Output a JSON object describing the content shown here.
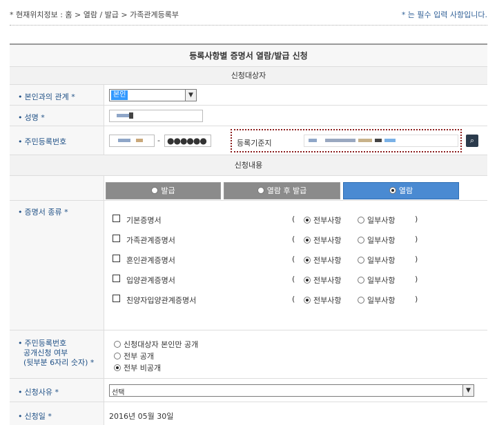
{
  "topbar": {
    "location": "* 현재위치정보 : 홈 > 열람 / 발급 > 가족관계등록부",
    "required_note": "* 는 필수 입력 사항입니다."
  },
  "form": {
    "title": "등록사항별 증명서 열람/발급 신청",
    "section_applicant": "신청대상자",
    "section_content": "신청내용",
    "relation": {
      "label": "본인과의 관계 *",
      "value": "본인"
    },
    "name": {
      "label": "성명 *"
    },
    "resident_no": {
      "label": "주민등록번호",
      "dash": "-",
      "masked": "●●●●●●"
    },
    "base_reg": {
      "label": "등록기준지"
    },
    "tabs": [
      {
        "label": "발급",
        "selected": false
      },
      {
        "label": "열람 후 발급",
        "selected": false
      },
      {
        "label": "열람",
        "selected": true
      }
    ],
    "cert_type": {
      "label": "증명서 종류 *",
      "paren_open": "(",
      "paren_close": ")",
      "opt_all": "전부사항",
      "opt_partial": "일부사항",
      "items": [
        {
          "name": "기본증명서"
        },
        {
          "name": "가족관계증명서"
        },
        {
          "name": "혼인관계증명서"
        },
        {
          "name": "입양관계증명서"
        },
        {
          "name": "친양자입양관계증명서"
        }
      ]
    },
    "disclosure": {
      "label_line1": "주민등록번호",
      "label_line2": "공개신청 여부",
      "label_line3": "(뒷부분 6자리 숫자) *",
      "options": [
        {
          "label": "신청대상자 본인만 공개",
          "selected": false
        },
        {
          "label": "전부 공개",
          "selected": false
        },
        {
          "label": "전부 비공개",
          "selected": true
        }
      ]
    },
    "reason": {
      "label": "신청사유 *",
      "value": "선택"
    },
    "apply_date": {
      "label": "신청일 *",
      "value": "2016년 05월 30일"
    }
  },
  "colors": {
    "label_blue": "#1f5086",
    "tab_active": "#4a8ad2",
    "tab_inactive": "#8b8b8b",
    "highlight_border": "#8a1b1b"
  }
}
